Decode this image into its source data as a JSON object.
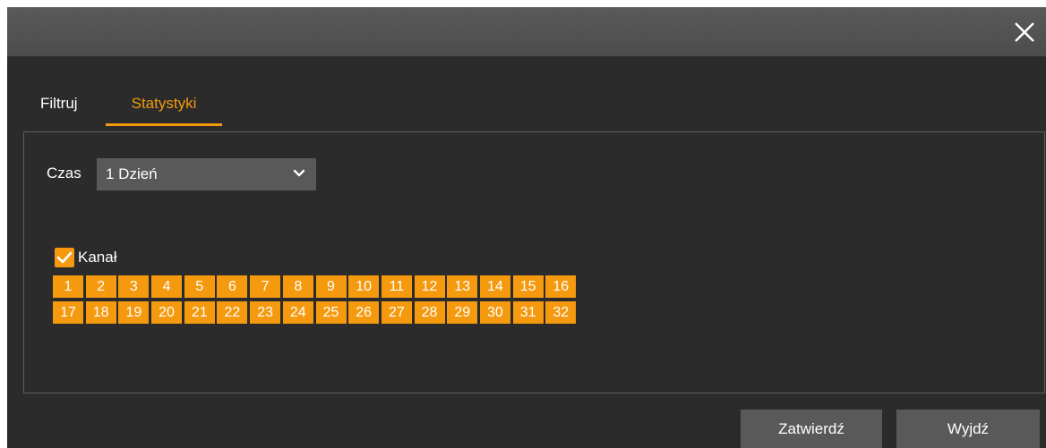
{
  "titlebar": {
    "close_icon": "close-icon"
  },
  "tabs": [
    {
      "label": "Filtruj",
      "active": false
    },
    {
      "label": "Statystyki",
      "active": true
    }
  ],
  "time": {
    "label": "Czas",
    "selected": "1 Dzień",
    "dropdown_icon": "chevron-down-icon"
  },
  "channels": {
    "label": "Kanał",
    "all_checked": true,
    "row1": [
      "1",
      "2",
      "3",
      "4",
      "5",
      "6",
      "7",
      "8",
      "9",
      "10",
      "11",
      "12",
      "13",
      "14",
      "15",
      "16"
    ],
    "row2": [
      "17",
      "18",
      "19",
      "20",
      "21",
      "22",
      "23",
      "24",
      "25",
      "26",
      "27",
      "28",
      "29",
      "30",
      "31",
      "32"
    ]
  },
  "buttons": {
    "confirm": "Zatwierdź",
    "exit": "Wyjdź"
  },
  "colors": {
    "accent": "#f59a0e",
    "background": "#2b2b2b",
    "titlebar": "#4f4f4f",
    "control": "#595959"
  }
}
